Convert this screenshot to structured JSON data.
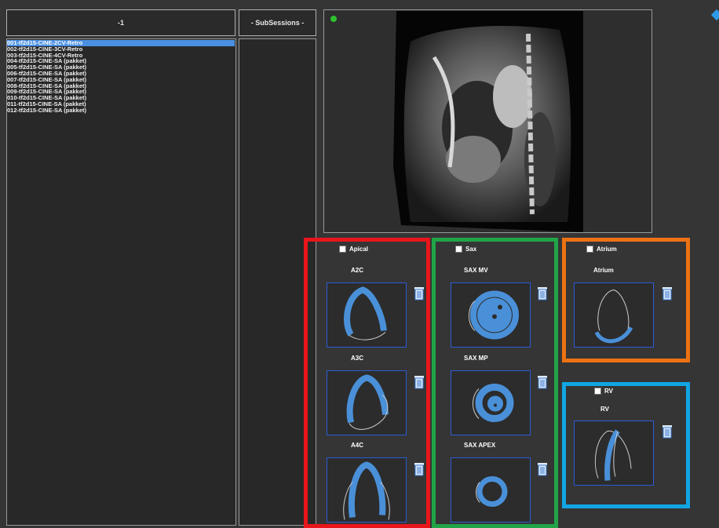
{
  "left_header": "-1",
  "sub_header": "- SubSessions -",
  "series": [
    "001-tf2d15-CINE-2CV-Retro",
    "002-tf2d15-CINE-3CV-Retro",
    "003-tf2d15-CINE-4CV-Retro",
    "004-tf2d15-CINE-SA (pakket)",
    "005-tf2d15-CINE-SA (pakket)",
    "006-tf2d15-CINE-SA (pakket)",
    "007-tf2d15-CINE-SA (pakket)",
    "008-tf2d15-CINE-SA (pakket)",
    "009-tf2d15-CINE-SA (pakket)",
    "010-tf2d15-CINE-SA (pakket)",
    "011-tf2d15-CINE-SA (pakket)",
    "012-tf2d15-CINE-SA (pakket)"
  ],
  "selected_index": 0,
  "groups": {
    "apical": {
      "label": "Apical",
      "color": "#e8161b",
      "views": [
        "A2C",
        "A3C",
        "A4C"
      ]
    },
    "sax": {
      "label": "Sax",
      "color": "#21a448",
      "views": [
        "SAX MV",
        "SAX MP",
        "SAX APEX"
      ]
    },
    "atrium": {
      "label": "Atrium",
      "color": "#ec7213",
      "views": [
        "Atrium"
      ]
    },
    "rv": {
      "label": "RV",
      "color": "#10a6e3",
      "views": [
        "RV"
      ]
    }
  },
  "icons": {
    "trash": "trash-icon",
    "status": "green-dot-icon"
  }
}
